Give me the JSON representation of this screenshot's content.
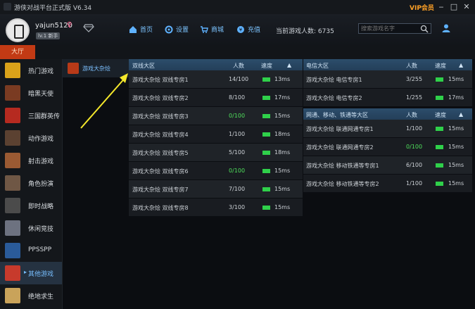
{
  "window": {
    "title": "游侠对战平台正式版 V6.34",
    "vip_label": "VIP会员"
  },
  "user": {
    "name": "yajun5120",
    "gender_icon": "♀",
    "level": "lv.1 新手"
  },
  "nav": [
    {
      "label": "首页",
      "icon": "home-icon"
    },
    {
      "label": "设置",
      "icon": "gear-icon"
    },
    {
      "label": "商城",
      "icon": "cart-icon"
    },
    {
      "label": "充值",
      "icon": "coin-icon"
    }
  ],
  "online": {
    "label": "当前游戏人数: ",
    "count": "6735"
  },
  "search": {
    "placeholder": "搜索游戏名字"
  },
  "tabs": {
    "hall": "大厅"
  },
  "sidebar": {
    "items": [
      {
        "label": "热门游戏",
        "color": "#d9a21a"
      },
      {
        "label": "暗黑天使",
        "color": "#7a3b22"
      },
      {
        "label": "三国群英传",
        "color": "#b62a20"
      },
      {
        "label": "动作游戏",
        "color": "#5b4131"
      },
      {
        "label": "射击游戏",
        "color": "#9a5a33"
      },
      {
        "label": "角色扮演",
        "color": "#6f5745"
      },
      {
        "label": "即时战略",
        "color": "#4b4b4b"
      },
      {
        "label": "休闲竞技",
        "color": "#6d7280"
      },
      {
        "label": "PPSSPP",
        "color": "#2a5b9a"
      },
      {
        "label": "其他游戏",
        "color": "#c73a2c",
        "active": true
      },
      {
        "label": "绝地求生",
        "color": "#c9a35a"
      }
    ]
  },
  "subcategory": {
    "label": "游戏大杂烩"
  },
  "left_table": {
    "header": {
      "name": "双线大区",
      "people": "人数",
      "speed": "速度",
      "sort": "▲"
    },
    "rows": [
      {
        "name": "游戏大杂烩 双线专房1",
        "count": "14/100",
        "ping": "13ms"
      },
      {
        "name": "游戏大杂烩 双线专房2",
        "count": "8/100",
        "ping": "17ms"
      },
      {
        "name": "游戏大杂烩 双线专房3",
        "count": "0/100",
        "ping": "15ms"
      },
      {
        "name": "游戏大杂烩 双线专房4",
        "count": "1/100",
        "ping": "18ms"
      },
      {
        "name": "游戏大杂烩 双线专房5",
        "count": "5/100",
        "ping": "18ms"
      },
      {
        "name": "游戏大杂烩 双线专房6",
        "count": "0/100",
        "ping": "15ms"
      },
      {
        "name": "游戏大杂烩 双线专房7",
        "count": "7/100",
        "ping": "15ms"
      },
      {
        "name": "游戏大杂烩 双线专房8",
        "count": "3/100",
        "ping": "15ms"
      }
    ]
  },
  "right_table_1": {
    "header": {
      "name": "电信大区",
      "people": "人数",
      "speed": "速度",
      "sort": "▲"
    },
    "rows": [
      {
        "name": "游戏大杂烩 电信专房1",
        "count": "3/255",
        "ping": "15ms"
      },
      {
        "name": "游戏大杂烩 电信专房2",
        "count": "1/255",
        "ping": "17ms"
      }
    ]
  },
  "right_table_2": {
    "header": {
      "name": "网通、移动、铁通等大区",
      "people": "人数",
      "speed": "速度",
      "sort": "▲"
    },
    "rows": [
      {
        "name": "游戏大杂烩 联通网通专房1",
        "count": "1/100",
        "ping": "15ms"
      },
      {
        "name": "游戏大杂烩 联通网通专房2",
        "count": "0/100",
        "ping": "15ms"
      },
      {
        "name": "游戏大杂烩 移动铁通等专房1",
        "count": "6/100",
        "ping": "15ms"
      },
      {
        "name": "游戏大杂烩 移动铁通等专房2",
        "count": "1/100",
        "ping": "15ms"
      }
    ]
  },
  "colors": {
    "accent": "#7cc4ff",
    "tab_active": "#c23a14",
    "ping_good": "#2fd04a",
    "vip": "#ffa126"
  }
}
